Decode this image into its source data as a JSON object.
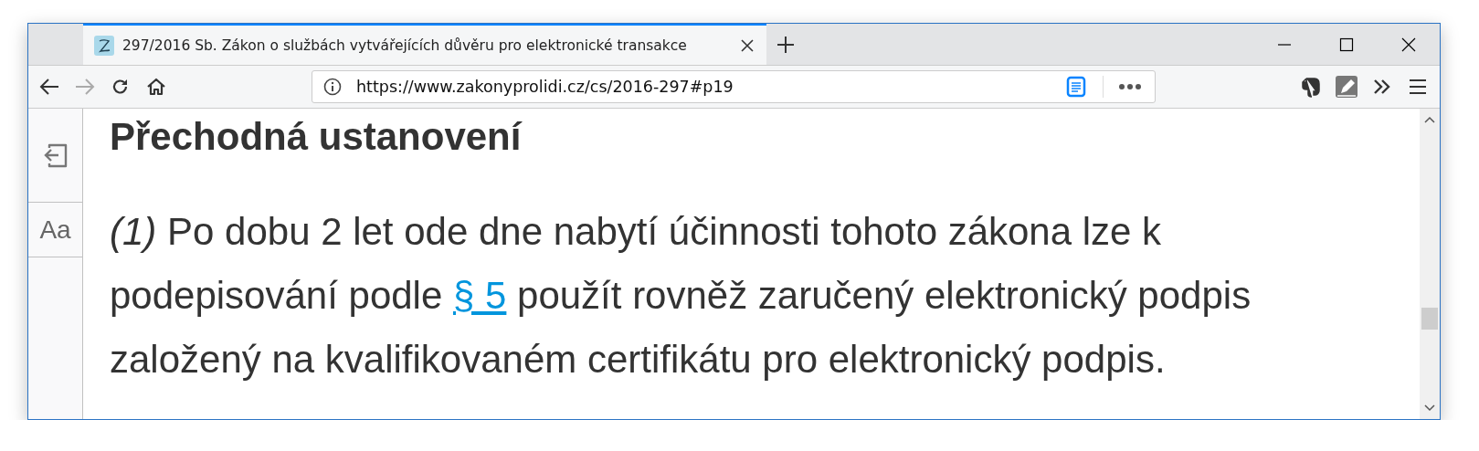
{
  "tabs": [
    {
      "title": "297/2016 Sb. Zákon o službách vytvářejících důvěru pro elektronické transakce",
      "selected": true
    }
  ],
  "address_bar": {
    "url": "https://www.zakonyprolidi.cz/cs/2016-297#p19"
  },
  "reader_sidebar": {
    "font_button": "Aa"
  },
  "article": {
    "heading": "Přechodná ustanovení",
    "paragraph": {
      "number": "(1)",
      "before": "Po dobu 2 let ode dne nabytí účinnosti tohoto zákona lze k podepisování podle",
      "link": "§ 5",
      "after": "použít rovněž zaručený elektronický podpis založený na kvalifikovaném certifikátu pro elektronický podpis."
    }
  }
}
